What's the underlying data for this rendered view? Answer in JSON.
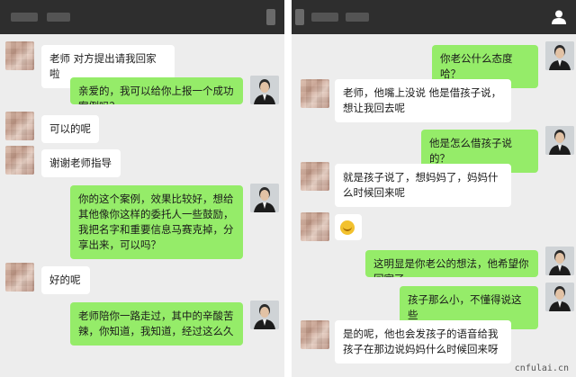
{
  "left_chat": {
    "messages": [
      {
        "side": "in",
        "text": "老师 对方提出请我回家啦"
      },
      {
        "side": "out",
        "text": "亲爱的，我可以给你上报一个成功案例吗？"
      },
      {
        "side": "in",
        "text": "可以的呢"
      },
      {
        "side": "in",
        "text": "谢谢老师指导"
      },
      {
        "side": "out",
        "text": "你的这个案例，效果比较好，想给其他像你这样的委托人一些鼓励，我把名字和重要信息马赛克掉，分享出来，可以吗？"
      },
      {
        "side": "in",
        "text": "好的呢"
      },
      {
        "side": "out",
        "text": "老师陪你一路走过，其中的辛酸苦辣，你知道，我知道，经过这么久"
      }
    ]
  },
  "right_chat": {
    "messages": [
      {
        "side": "out",
        "text": "你老公什么态度哈？"
      },
      {
        "side": "in",
        "text": "老师，他嘴上没说 他是借孩子说，想让我回去呢"
      },
      {
        "side": "out",
        "text": "他是怎么借孩子说的？"
      },
      {
        "side": "in",
        "text": "就是孩子说了，想妈妈了，妈妈什么时候回来呢"
      },
      {
        "side": "in",
        "emoji": true,
        "icon": "smile-emoji-icon"
      },
      {
        "side": "out",
        "text": "这明显是你老公的想法，他希望你回家了"
      },
      {
        "side": "out",
        "text": "孩子那么小，不懂得说这些"
      },
      {
        "side": "in",
        "text": "是的呢，他也会发孩子的语音给我孩子在那边说妈妈什么时候回来呀"
      }
    ]
  },
  "watermark": "cnfulai.cn",
  "colors": {
    "outgoing_bubble": "#95ec69",
    "incoming_bubble": "#ffffff",
    "chat_background": "#ededed",
    "topbar": "#2e2e2e"
  }
}
